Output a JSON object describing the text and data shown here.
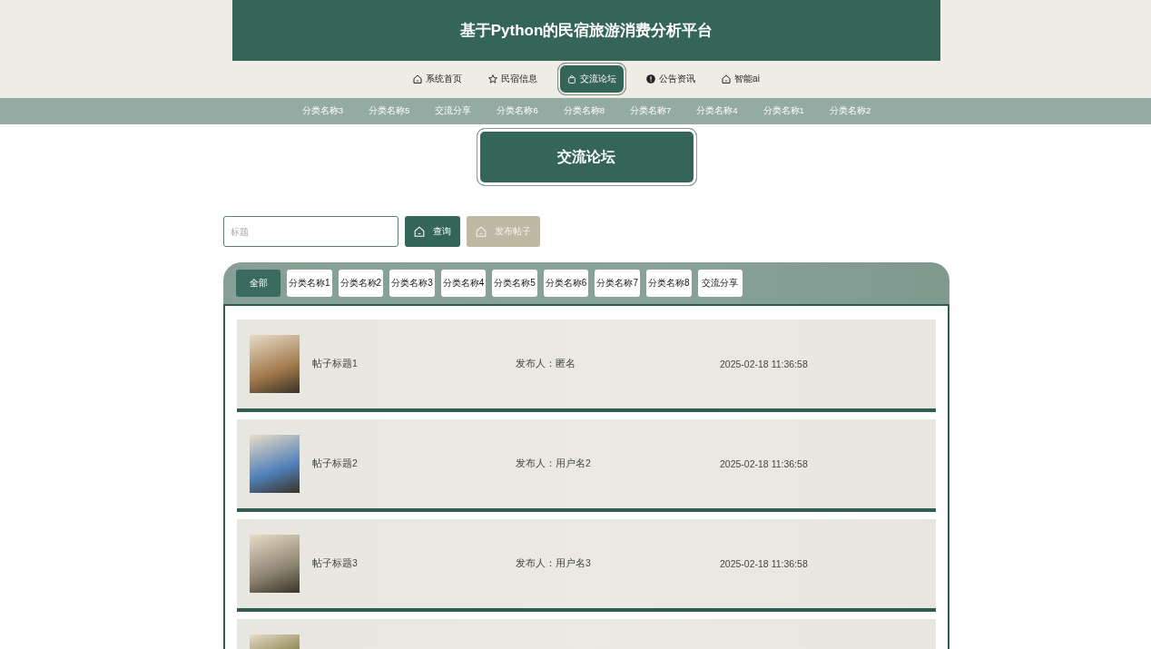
{
  "header": {
    "title": "基于Python的民宿旅游消费分析平台"
  },
  "nav": [
    {
      "label": "系统首页",
      "selected": false
    },
    {
      "label": "民宿信息",
      "selected": false
    },
    {
      "label": "交流论坛",
      "selected": true
    },
    {
      "label": "公告资讯",
      "selected": false
    },
    {
      "label": "智能ai",
      "selected": false
    }
  ],
  "subnav": [
    "分类名称3",
    "分类名称5",
    "交流分享",
    "分类名称6",
    "分类名称8",
    "分类名称7",
    "分类名称4",
    "分类名称1",
    "分类名称2"
  ],
  "page_title": "交流论坛",
  "search": {
    "placeholder": "标题",
    "buttons": [
      {
        "label": "查询",
        "kind": "primary"
      },
      {
        "label": "发布帖子",
        "kind": "muted"
      }
    ]
  },
  "categories": [
    {
      "label": "全部",
      "selected": true
    },
    {
      "label": "分类名称1",
      "selected": false
    },
    {
      "label": "分类名称2",
      "selected": false
    },
    {
      "label": "分类名称3",
      "selected": false
    },
    {
      "label": "分类名称4",
      "selected": false
    },
    {
      "label": "分类名称5",
      "selected": false
    },
    {
      "label": "分类名称6",
      "selected": false
    },
    {
      "label": "分类名称7",
      "selected": false
    },
    {
      "label": "分类名称8",
      "selected": false
    },
    {
      "label": "交流分享",
      "selected": false
    }
  ],
  "posts": [
    {
      "photo": true,
      "title": "帖子标题1",
      "author": "发布人：匿名",
      "time": "2025-02-18 11:36:58"
    },
    {
      "photo": true,
      "title": "帖子标题2",
      "author": "发布人：用户名2",
      "time": "2025-02-18 11:36:58"
    },
    {
      "photo": true,
      "title": "帖子标题3",
      "author": "发布人：用户名3",
      "time": "2025-02-18 11:36:58"
    },
    {
      "photo": true
    }
  ]
}
